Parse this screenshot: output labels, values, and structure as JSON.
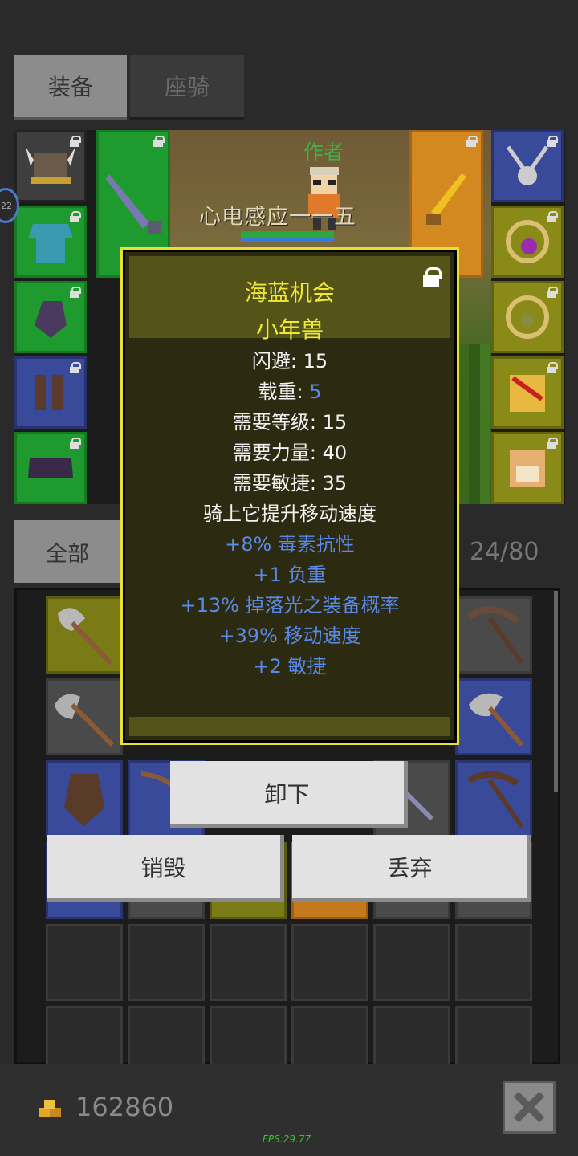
{
  "tabs": {
    "equip": "装备",
    "mount": "座骑"
  },
  "character": {
    "author_label": "作者",
    "pet_name": "心电感应一一五",
    "level_badge": "22"
  },
  "inventory": {
    "filter_tab": "全部",
    "capacity": "24/80"
  },
  "tooltip": {
    "title": "海蓝机会",
    "subtitle": "小年兽",
    "stats": [
      {
        "label": "闪避: ",
        "value": "15"
      },
      {
        "label": "载重: ",
        "value": "5"
      },
      {
        "label": "需要等级: ",
        "value": "15"
      },
      {
        "label": "需要力量: ",
        "value": "40"
      },
      {
        "label": "需要敏捷: ",
        "value": "35"
      }
    ],
    "description": "骑上它提升移动速度",
    "bonuses": [
      "+8% 毒素抗性",
      "+1 负重",
      "+13% 掉落光之装备概率",
      "+39% 移动速度",
      "+2 敏捷"
    ]
  },
  "actions": {
    "unequip": "卸下",
    "destroy": "销毁",
    "discard": "丢弃"
  },
  "footer": {
    "gold": "162860",
    "fps": "FPS:29.77"
  },
  "colors": {
    "tooltip_border": "#e8e02a",
    "tooltip_title": "#f0e838",
    "bonus_text": "#5a8ae8",
    "fps_text": "#2ec92e"
  }
}
